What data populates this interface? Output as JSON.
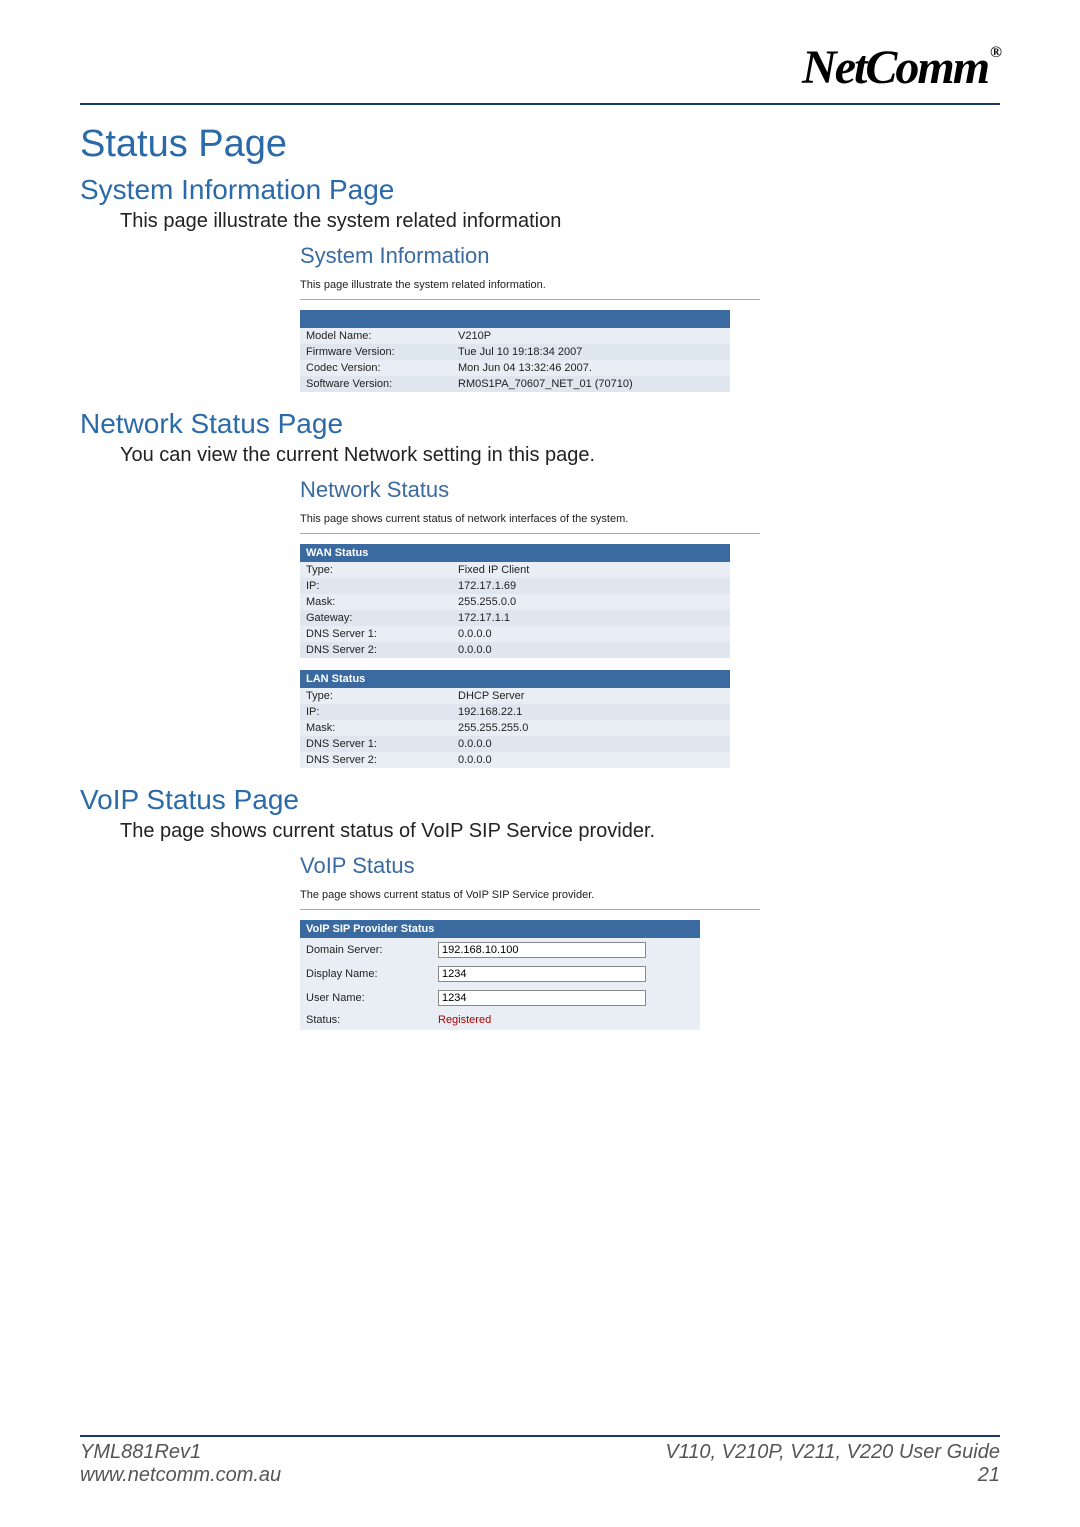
{
  "brand": "NetComm",
  "brand_reg": "®",
  "main_title": "Status Page",
  "sections": {
    "sys": {
      "subtitle": "System Information Page",
      "desc": "This page illustrate the system related information",
      "embed_title": "System Information",
      "embed_desc": "This page illustrate the system related information.",
      "rows": [
        {
          "label": "Model Name:",
          "value": "V210P"
        },
        {
          "label": "Firmware Version:",
          "value": "Tue Jul 10 19:18:34 2007"
        },
        {
          "label": "Codec Version:",
          "value": "Mon Jun 04 13:32:46 2007."
        },
        {
          "label": "Software Version:",
          "value": "RM0S1PA_70607_NET_01 (70710)"
        }
      ]
    },
    "net": {
      "subtitle": "Network Status Page",
      "desc": "You can view the current Network setting in this page.",
      "embed_title": "Network Status",
      "embed_desc": "This page shows current status of network interfaces of the system.",
      "wan": {
        "header": "WAN Status",
        "rows": [
          {
            "label": "Type:",
            "value": "Fixed IP Client"
          },
          {
            "label": "IP:",
            "value": "172.17.1.69"
          },
          {
            "label": "Mask:",
            "value": "255.255.0.0"
          },
          {
            "label": "Gateway:",
            "value": "172.17.1.1"
          },
          {
            "label": "DNS Server 1:",
            "value": "0.0.0.0"
          },
          {
            "label": "DNS Server 2:",
            "value": "0.0.0.0"
          }
        ]
      },
      "lan": {
        "header": "LAN Status",
        "rows": [
          {
            "label": "Type:",
            "value": "DHCP Server"
          },
          {
            "label": "IP:",
            "value": "192.168.22.1"
          },
          {
            "label": "Mask:",
            "value": "255.255.255.0"
          },
          {
            "label": "DNS Server 1:",
            "value": "0.0.0.0"
          },
          {
            "label": "DNS Server 2:",
            "value": "0.0.0.0"
          }
        ]
      }
    },
    "voip": {
      "subtitle": "VoIP Status Page",
      "desc": "The page shows current status of VoIP SIP Service provider.",
      "embed_title": "VoIP Status",
      "embed_desc": "The page shows current status of VoIP SIP Service provider.",
      "header": "VoIP SIP Provider Status",
      "domain_label": "Domain Server:",
      "domain_value": "192.168.10.100",
      "display_label": "Display Name:",
      "display_value": "1234",
      "user_label": "User Name:",
      "user_value": "1234",
      "status_label": "Status:",
      "status_value": "Registered"
    }
  },
  "footer": {
    "left1": "YML881Rev1",
    "left2": "www.netcomm.com.au",
    "right1": "V110, V210P, V211, V220 User Guide",
    "right2": "21"
  }
}
